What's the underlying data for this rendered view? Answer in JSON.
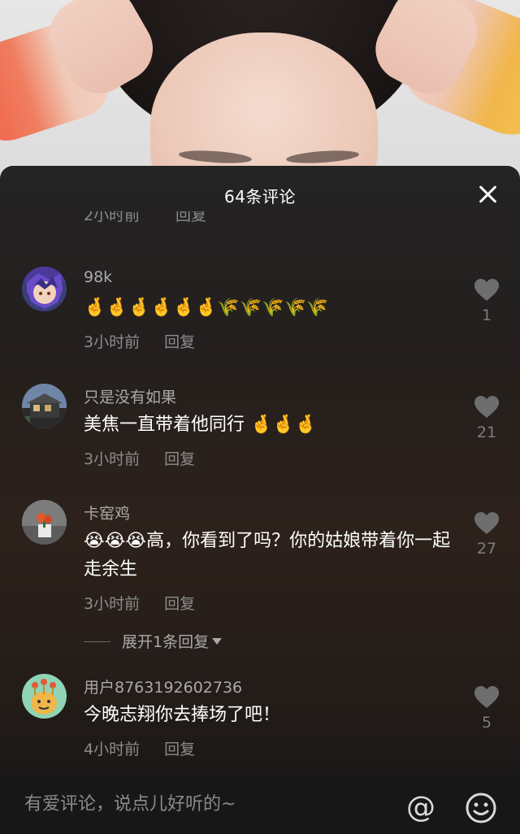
{
  "comments_panel": {
    "title": "64条评论"
  },
  "clipped_meta": {
    "time": "2小时前",
    "reply": "回复"
  },
  "comments": [
    {
      "username": "98k",
      "emoji_line": "🤞🤞🤞🤞🤞🤞🌾🌾🌾🌾🌾",
      "time": "3小时前",
      "reply": "回复",
      "likes": "1"
    },
    {
      "username": "只是没有如果",
      "text": "美焦一直带着他同行",
      "emoji_suffix": "🤞🤞🤞",
      "time": "3小时前",
      "reply": "回复",
      "likes": "21"
    },
    {
      "username": "卡窑鸡",
      "emoji_prefix": "😭😭😭",
      "text": "高，你看到了吗？你的姑娘带着你一起走余生",
      "time": "3小时前",
      "reply": "回复",
      "likes": "27"
    },
    {
      "username": "用户8763192602736",
      "text": "今晚志翔你去捧场了吧！",
      "time": "4小时前",
      "reply": "回复",
      "likes": "5"
    }
  ],
  "expand_replies": "展开1条回复",
  "input": {
    "placeholder": "有爱评论，说点儿好听的~"
  },
  "icons": {
    "close": "close-icon",
    "at": "at-icon",
    "emoji": "emoji-face-icon",
    "like": "heart-icon"
  },
  "colors": {
    "sheet_bg": "#242424",
    "text_primary": "#ffffff",
    "text_secondary": "#8c8c8c",
    "heart": "#6e6e6e",
    "input_bar": "#171717"
  }
}
